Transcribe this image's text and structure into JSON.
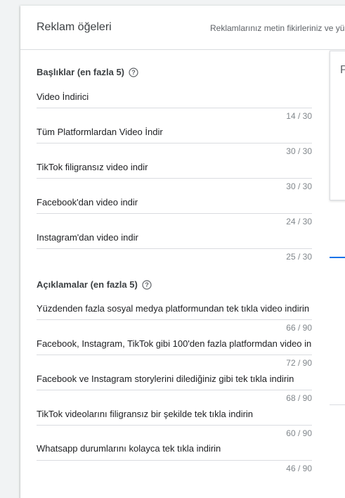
{
  "header": {
    "title": "Reklam öğeleri",
    "subtitle": "Reklamlarınız metin fikirleriniz ve yük"
  },
  "preview": {
    "letter": "P"
  },
  "headlines": {
    "title": "Başlıklar (en fazla 5)",
    "help_icon": "help-circle-icon",
    "items": [
      {
        "text": "Video İndirici",
        "counter": "14 / 30"
      },
      {
        "text": "Tüm Platformlardan Video İndir",
        "counter": "30 / 30"
      },
      {
        "text": "TikTok filigransız video indir",
        "counter": "30 / 30"
      },
      {
        "text": "Facebook'dan video indir",
        "counter": "24 / 30"
      },
      {
        "text": "Instagram'dan video indir",
        "counter": "25 / 30"
      }
    ]
  },
  "descriptions": {
    "title": "Açıklamalar (en fazla 5)",
    "help_icon": "help-circle-icon",
    "items": [
      {
        "text": "Yüzdenden fazla sosyal medya platformundan tek tıkla video indirin",
        "counter": "66 / 90"
      },
      {
        "text": "Facebook, Instagram, TikTok gibi 100'den fazla platformdan video in",
        "counter": "72 / 90"
      },
      {
        "text": "Facebook ve Instagram storylerini dilediğiniz gibi tek tıkla indirin",
        "counter": "68 / 90"
      },
      {
        "text": "TikTok videolarını filigransız bir şekilde tek tıkla indirin",
        "counter": "60 / 90"
      },
      {
        "text": "Whatsapp durumlarını kolayca tek tıkla indirin",
        "counter": "46 / 90"
      }
    ]
  },
  "colors": {
    "accent": "#1a73e8",
    "divider": "#dadce0",
    "counter_text": "#80868b"
  }
}
